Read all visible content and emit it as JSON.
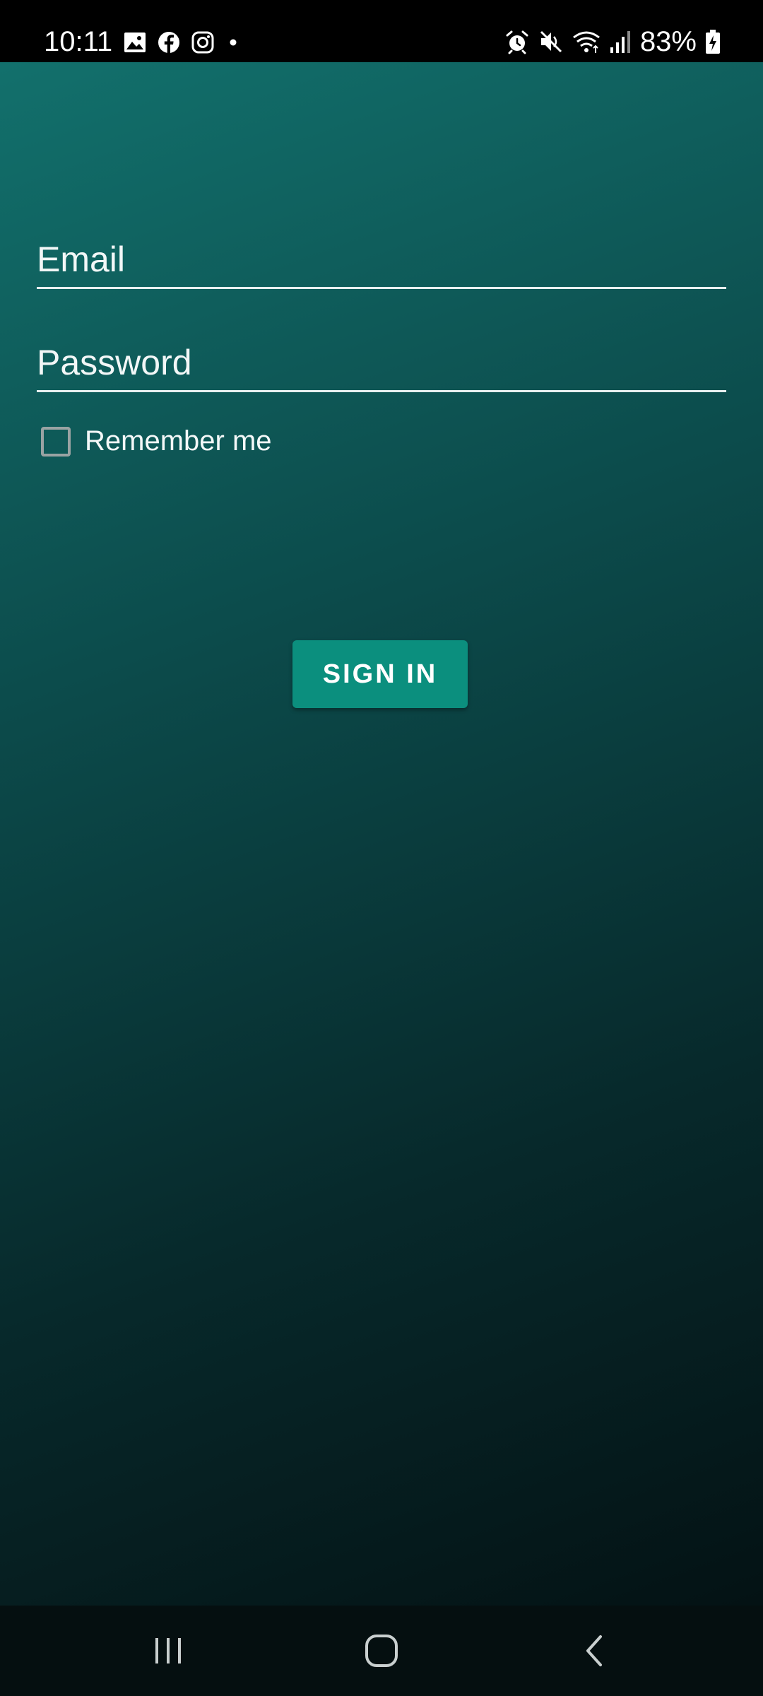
{
  "status_bar": {
    "time": "10:11",
    "battery_percent": "83%",
    "left_icons": [
      "gallery-icon",
      "facebook-icon",
      "instagram-icon",
      "notification-dot-icon"
    ],
    "right_icons": [
      "alarm-icon",
      "mute-icon",
      "wifi-icon",
      "signal-icon",
      "battery-charging-icon"
    ]
  },
  "login_form": {
    "email": {
      "placeholder": "Email",
      "value": ""
    },
    "password": {
      "placeholder": "Password",
      "value": ""
    },
    "remember_me": {
      "label": "Remember me",
      "checked": false
    },
    "sign_in_label": "SIGN IN"
  },
  "nav_bar": {
    "buttons": [
      "recents-icon",
      "home-icon",
      "back-icon"
    ]
  },
  "colors": {
    "gradient_top": "#12706c",
    "gradient_bottom": "#041214",
    "button_bg": "#0b8f7e",
    "status_bar_bg": "#000000",
    "nav_bar_bg": "#050f10"
  }
}
